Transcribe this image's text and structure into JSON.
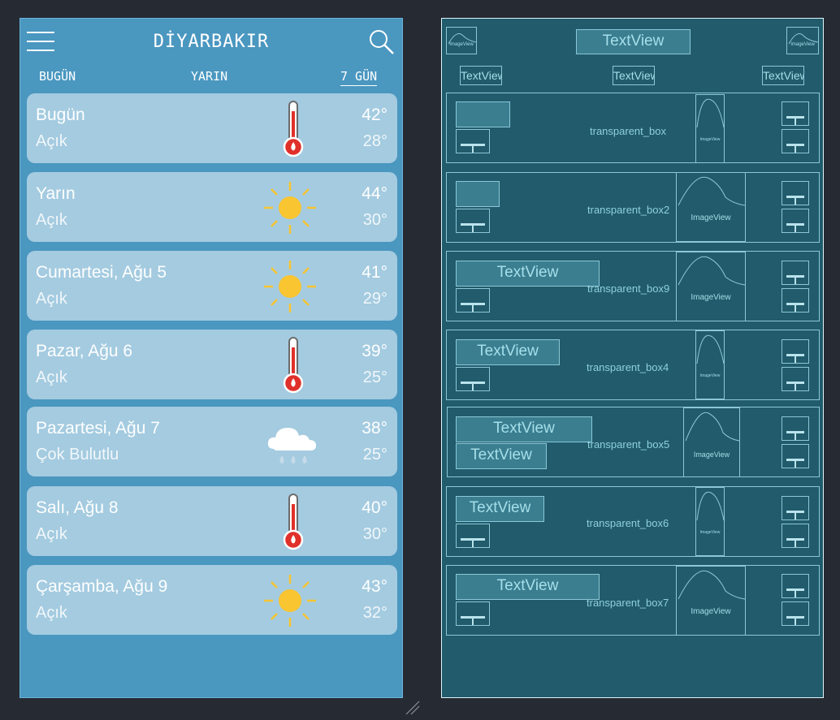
{
  "header": {
    "city": "DİYARBAKIR"
  },
  "tabs": [
    "BUGÜN",
    "YARIN",
    "7 GÜN"
  ],
  "days": [
    {
      "day": "Bugün",
      "condition": "Açık",
      "high": "42°",
      "low": "28°",
      "icon": "thermometer-icon"
    },
    {
      "day": "Yarın",
      "condition": "Açık",
      "high": "44°",
      "low": "30°",
      "icon": "sun-icon"
    },
    {
      "day": "Cumartesi, Ağu 5",
      "condition": "Açık",
      "high": "41°",
      "low": "29°",
      "icon": "sun-icon"
    },
    {
      "day": "Pazar, Ağu 6",
      "condition": "Açık",
      "high": "39°",
      "low": "25°",
      "icon": "thermometer-icon"
    },
    {
      "day": "Pazartesi, Ağu 7",
      "condition": "Çok Bulutlu",
      "high": "38°",
      "low": "25°",
      "icon": "rain-cloud-icon"
    },
    {
      "day": "Salı, Ağu 8",
      "condition": "Açık",
      "high": "40°",
      "low": "30°",
      "icon": "thermometer-icon"
    },
    {
      "day": "Çarşamba, Ağu 9",
      "condition": "Açık",
      "high": "43°",
      "low": "32°",
      "icon": "sun-icon"
    }
  ],
  "blueprint": {
    "title_text": "TextView",
    "tab_text": "TextView",
    "image_label": "ImageView",
    "textview_label": "TextView",
    "box_labels": [
      "transparent_box",
      "transparent_box2",
      "transparent_box9",
      "transparent_box4",
      "transparent_box5",
      "transparent_box6",
      "transparent_box7"
    ]
  },
  "colors": {
    "background": "#262a33",
    "phone": "#4a97c0",
    "card": "#a4cbe0",
    "blueprint": "#215b6c",
    "sun": "#f9c531",
    "thermo_red": "#e0302a"
  }
}
